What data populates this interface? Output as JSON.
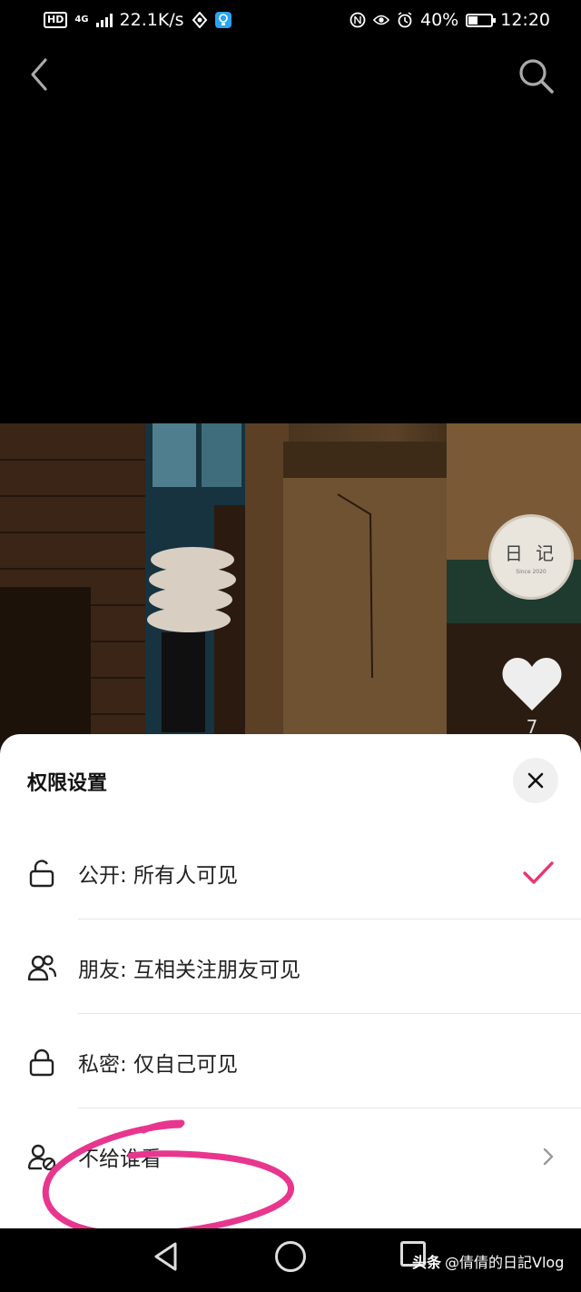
{
  "status_bar": {
    "hd_badge": "HD",
    "network_type": "4G",
    "speed": "22.1K/s",
    "battery_percent": "40%",
    "battery_level": 0.4,
    "time": "12:20"
  },
  "nav": {
    "back_icon": "chevron-left-icon",
    "search_icon": "search-icon"
  },
  "video": {
    "creator_avatar_text": "日 记",
    "creator_avatar_subtext": "Since 2020",
    "like_count": "7"
  },
  "sheet": {
    "title": "权限设置",
    "close_icon": "close-icon",
    "options": [
      {
        "label": "公开: 所有人可见",
        "icon": "unlock-icon",
        "selected": true
      },
      {
        "label": "朋友: 互相关注朋友可见",
        "icon": "friends-icon",
        "selected": false
      },
      {
        "label": "私密: 仅自己可见",
        "icon": "lock-icon",
        "selected": false
      },
      {
        "label": "不给谁看",
        "icon": "user-block-icon",
        "selected": false,
        "has_arrow": true
      }
    ],
    "accent_color": "#e8366f"
  },
  "navbar": {
    "watermark_source": "头条",
    "watermark_account": "@倩倩的日記Vlog"
  }
}
